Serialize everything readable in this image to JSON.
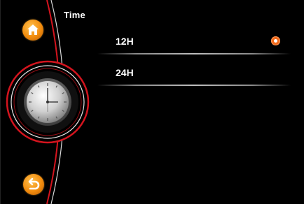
{
  "header": {
    "title": "Time"
  },
  "options": [
    {
      "label": "12H",
      "selected": true
    },
    {
      "label": "24H",
      "selected": false
    }
  ],
  "icons": {
    "home": "home-icon",
    "back": "back-icon",
    "clock": "clock-icon"
  },
  "colors": {
    "accent": "#f26a1b",
    "arc_red": "#d4141e",
    "icon_orange": "#f28c0e"
  }
}
